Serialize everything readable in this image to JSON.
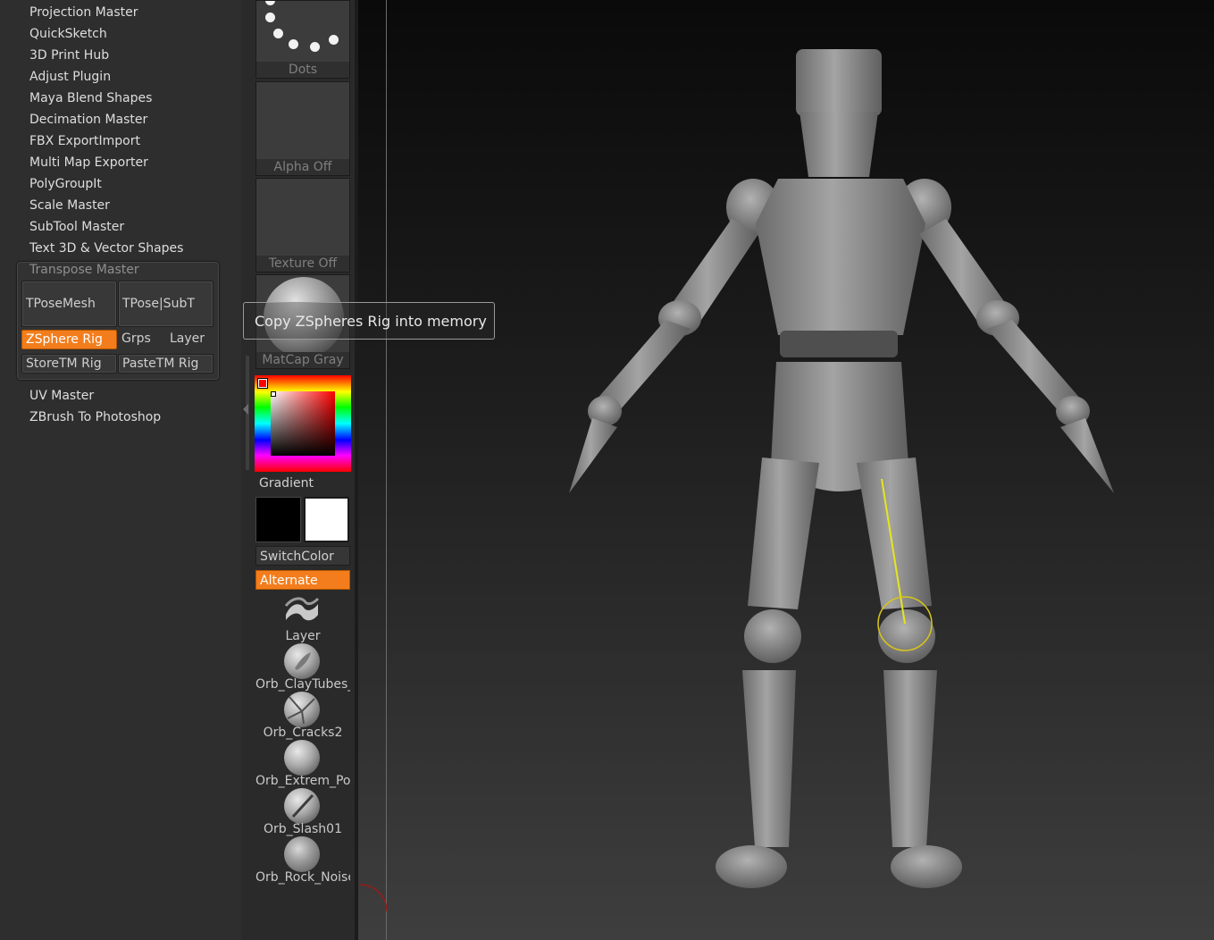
{
  "plugin_menu": {
    "items_top": [
      "Projection Master",
      "QuickSketch",
      "3D Print Hub",
      "Adjust Plugin",
      "Maya Blend Shapes",
      "Decimation Master",
      "FBX ExportImport",
      "Multi Map Exporter",
      "PolyGroupIt",
      "Scale Master",
      "SubTool Master",
      "Text 3D & Vector Shapes"
    ],
    "transpose_master": {
      "title": "Transpose Master",
      "tpose_mesh": "TPoseMesh",
      "tpose_subt": "TPose|SubT",
      "zsphere_rig": "ZSphere Rig",
      "grps": "Grps",
      "layer": "Layer",
      "storetm_rig": "StoreTM Rig",
      "pastetm_rig": "PasteTM Rig"
    },
    "items_bottom": [
      "UV Master",
      "ZBrush To Photoshop"
    ]
  },
  "shelf": {
    "stroke_label": "Dots",
    "alpha_label": "Alpha Off",
    "texture_label": "Texture Off",
    "material_label": "MatCap Gray",
    "gradient_label": "Gradient",
    "switch_color_label": "SwitchColor",
    "alternate_label": "Alternate",
    "main_color": "#000000",
    "secondary_color": "#ffffff",
    "brushes": [
      {
        "label": "Layer",
        "icon": "layer-brush-icon"
      },
      {
        "label": "Orb_ClayTubes_",
        "icon": "claytubes-brush-icon"
      },
      {
        "label": "Orb_Cracks2",
        "icon": "cracks-brush-icon"
      },
      {
        "label": "Orb_Extrem_Pol",
        "icon": "extrem-polish-brush-icon"
      },
      {
        "label": "Orb_Slash01",
        "icon": "slash-brush-icon"
      },
      {
        "label": "Orb_Rock_Noise",
        "icon": "rock-noise-brush-icon"
      }
    ]
  },
  "tooltip": {
    "text": "Copy ZSpheres Rig into memory"
  },
  "colors": {
    "accent": "#f37d1c",
    "model": "#8c8c8c",
    "transpose_line": "#e6e61a"
  }
}
